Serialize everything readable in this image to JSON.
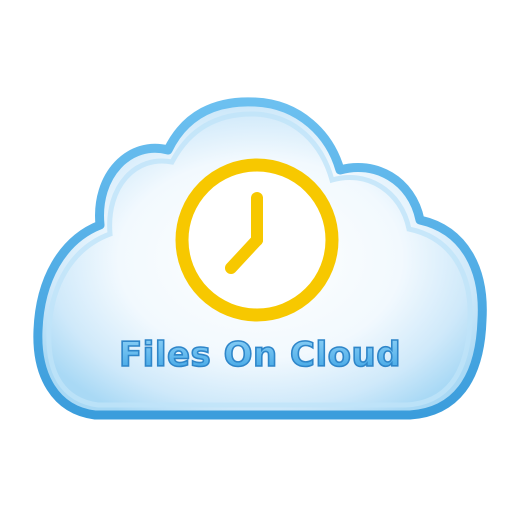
{
  "app": {
    "title": "Files On Cloud"
  },
  "icons": {
    "main": "cloud-icon",
    "badge": "clock-icon"
  },
  "colors": {
    "cloud_outline": "#5cb3e8",
    "cloud_fill_center": "#ffffff",
    "cloud_fill_edge": "#a9d9f5",
    "clock": "#f7c800",
    "title_fill": "#5bb7ec",
    "title_stroke": "#2f86c9"
  }
}
